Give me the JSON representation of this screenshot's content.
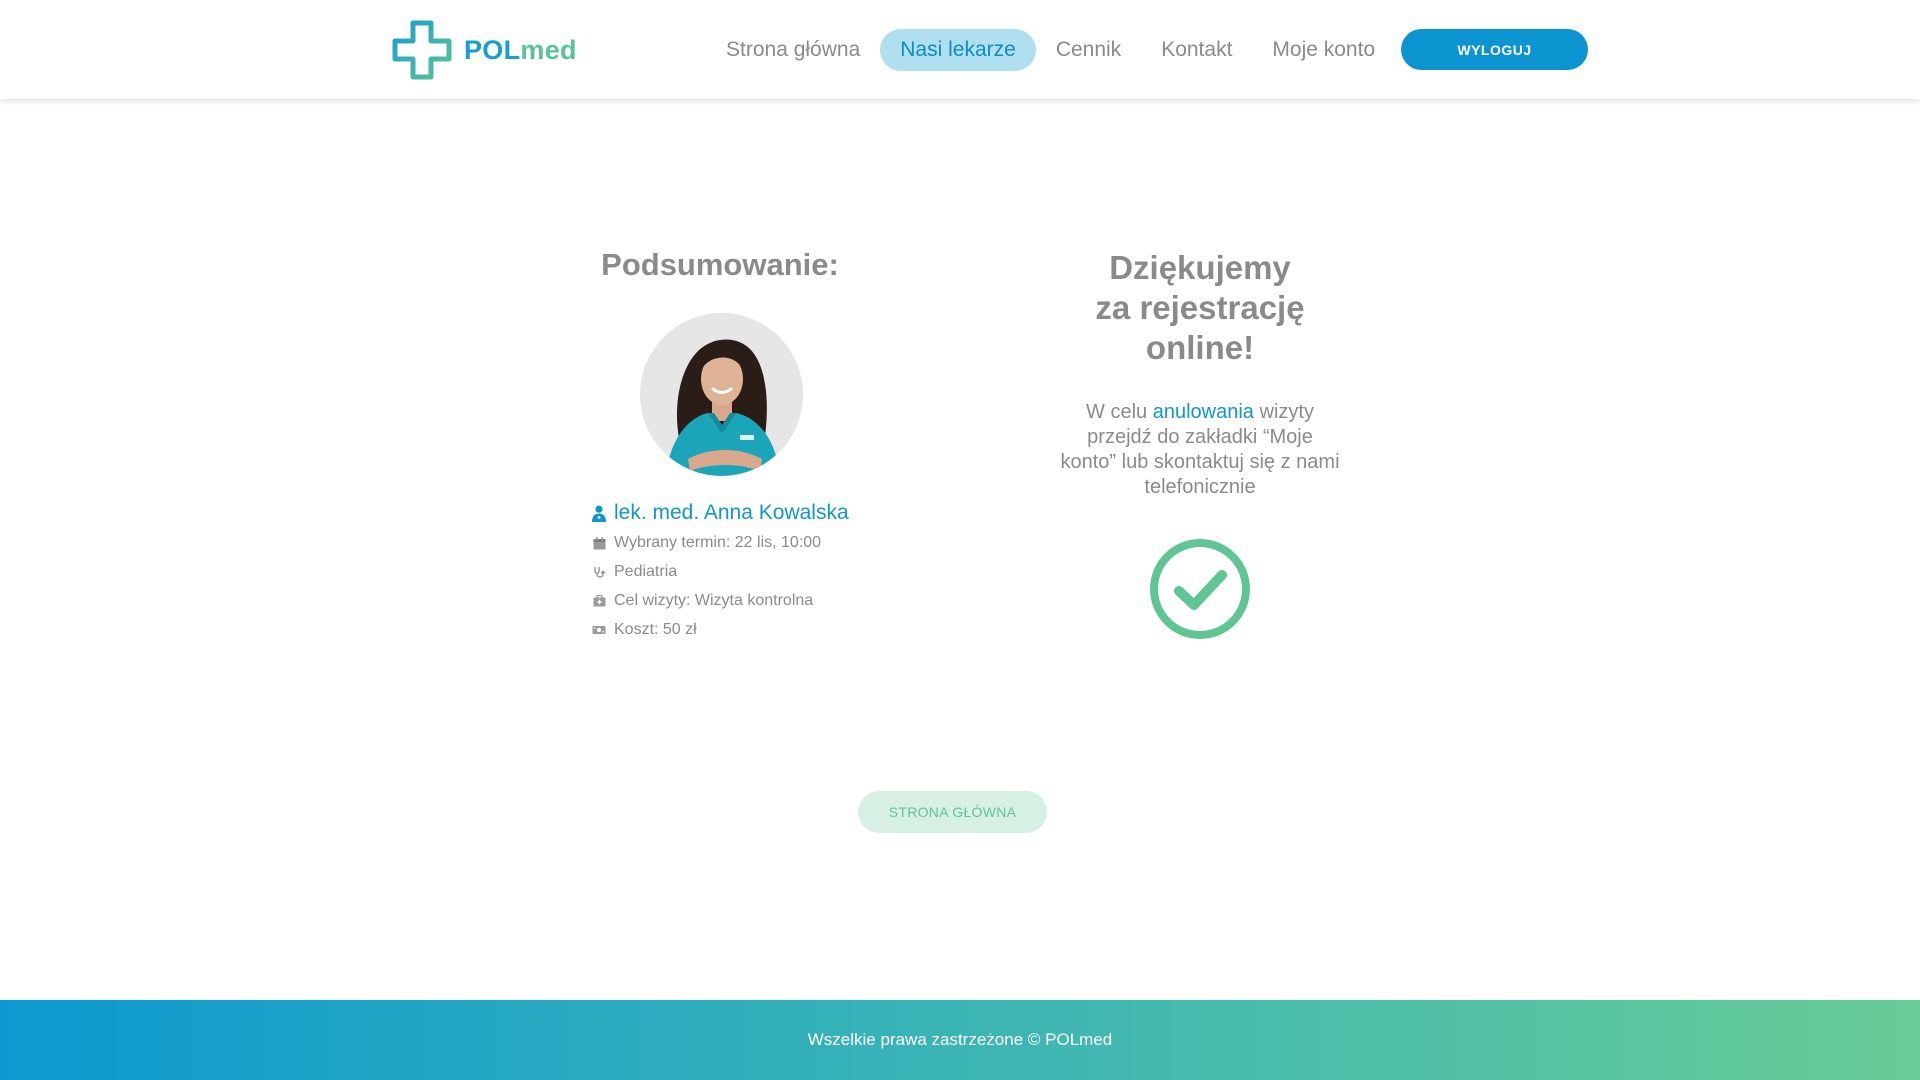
{
  "brand": {
    "part1": "POL",
    "part2": "med",
    "colors": {
      "primary_blue": "#0c94d0",
      "primary_green": "#58c495"
    }
  },
  "nav": {
    "items": [
      {
        "label": "Strona główna",
        "active": false
      },
      {
        "label": "Nasi lekarze",
        "active": true
      },
      {
        "label": "Cennik",
        "active": false
      },
      {
        "label": "Kontakt",
        "active": false
      },
      {
        "label": "Moje konto",
        "active": false
      }
    ],
    "logout_label": "WYLOGUJ"
  },
  "summary": {
    "title": "Podsumowanie:",
    "doctor_name": "lek. med. Anna Kowalska",
    "details": [
      {
        "icon": "calendar-icon",
        "text": "Wybrany termin: 22 lis, 10:00"
      },
      {
        "icon": "stethoscope-icon",
        "text": "Pediatria"
      },
      {
        "icon": "medkit-icon",
        "text": "Cel wizyty: Wizyta kontrolna"
      },
      {
        "icon": "money-icon",
        "text": "Koszt: 50 zł"
      }
    ]
  },
  "thanks": {
    "title_line1": "Dziękujemy",
    "title_line2": "za rejestrację",
    "title_line3": "online!",
    "text_before": "W celu ",
    "text_link": "anulowania",
    "text_after": " wizyty przejdź do zakładki “Moje konto” lub skontaktuj się z nami telefonicznie",
    "status_icon": "check-circle-icon"
  },
  "home_button_label": "STRONA GŁÓWNA",
  "footer": {
    "text": "Wszelkie prawa zastrzeżone © POLmed"
  }
}
